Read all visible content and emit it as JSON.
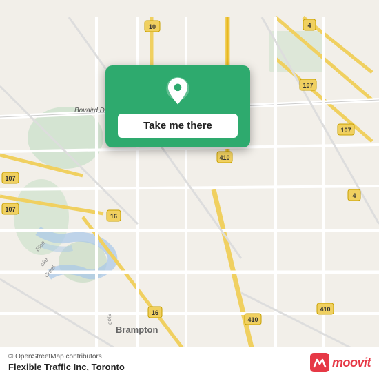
{
  "map": {
    "background_color": "#f2efe9",
    "osm_credit": "© OpenStreetMap contributors",
    "location_name": "Flexible Traffic Inc, Toronto",
    "take_me_label": "Take me there"
  },
  "moovit": {
    "brand_name": "moovit",
    "brand_color": "#e63946"
  }
}
